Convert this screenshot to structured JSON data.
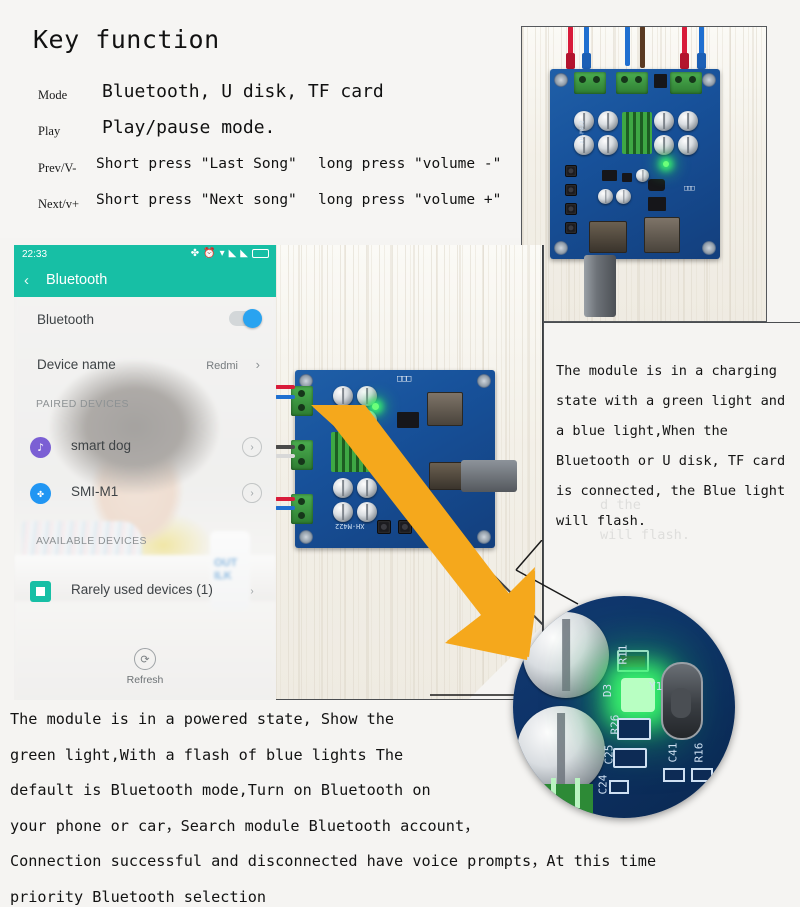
{
  "key_function": {
    "title": "Key function",
    "rows": [
      {
        "label": "Mode",
        "value": "Bluetooth, U disk, TF card",
        "value2": ""
      },
      {
        "label": "Play",
        "value": "Play/pause mode.",
        "value2": ""
      },
      {
        "label": "Prev/V-",
        "value": "Short press \"Last Song\"",
        "value2": "long press \"volume -\""
      },
      {
        "label": "Next/v+",
        "value": "Short press \"Next song\"",
        "value2": "long press \"volume +\""
      }
    ]
  },
  "phone": {
    "status_bar": {
      "time": "22:33",
      "icons": [
        "bluetooth-icon",
        "alarm-icon",
        "wifi-icon",
        "signal-icon",
        "signal-icon",
        "battery-icon"
      ]
    },
    "app_bar": {
      "back": "‹",
      "title": "Bluetooth"
    },
    "rows": [
      {
        "label": "Bluetooth",
        "value": "",
        "chevron": ""
      },
      {
        "label": "Device name",
        "value": "Redmi",
        "chevron": "›"
      }
    ],
    "paired_header": "PAIRED DEVICES",
    "paired_devices": [
      {
        "name": "smart dog",
        "icon": "headphone-icon",
        "color": "#7b5fd4",
        "glyph": "♪"
      },
      {
        "name": "SMI-M1",
        "icon": "bluetooth-icon",
        "color": "#2196f3",
        "glyph": "✤"
      }
    ],
    "available_header": "AVAILABLE DEVICES",
    "available_devices": [
      {
        "name": "Rarely used devices (1)",
        "icon": "square-icon",
        "color": "#17bfa5",
        "glyph": "■"
      }
    ],
    "refresh_label": "Refresh",
    "refresh_icon": "refresh-icon",
    "wallpaper_text": "OUT\nILK"
  },
  "right_text": {
    "lines": [
      "The module is in a charging",
      "state with a green light and",
      "a blue light,When the",
      "Bluetooth or U disk, TF card",
      "is connected, the Blue light",
      "will flash."
    ],
    "ghost_lines": [
      "d  the",
      "will flash."
    ]
  },
  "bottom_text": {
    "lines": [
      "The module is in a powered state, Show the",
      "green light,With a flash of blue lights The",
      "default is Bluetooth mode,Turn on Bluetooth on",
      "your phone or car，Search module Bluetooth account，",
      "Connection successful and disconnected have voice prompts，At this time",
      "priority Bluetooth selection"
    ]
  },
  "board": {
    "silkscreen_label": "XH-M422",
    "led_color": "#55ff6e",
    "pcb_color": "#1a57a0",
    "heatsink_color": "#2f8a36",
    "terminal_color": "#3d9e42"
  },
  "magnifier": {
    "silk_labels": [
      "R11",
      "D3",
      "R26",
      "C25",
      "C24",
      "Y1",
      "R16",
      "C41"
    ],
    "led_color": "#58ff72"
  },
  "arrow": {
    "color": "#f5a81c"
  },
  "colors": {
    "background": "#f5f4f2",
    "phone_accent": "#17bfa5",
    "toggle_on": "#29a3f0",
    "panel_border": "#4a4d50"
  }
}
